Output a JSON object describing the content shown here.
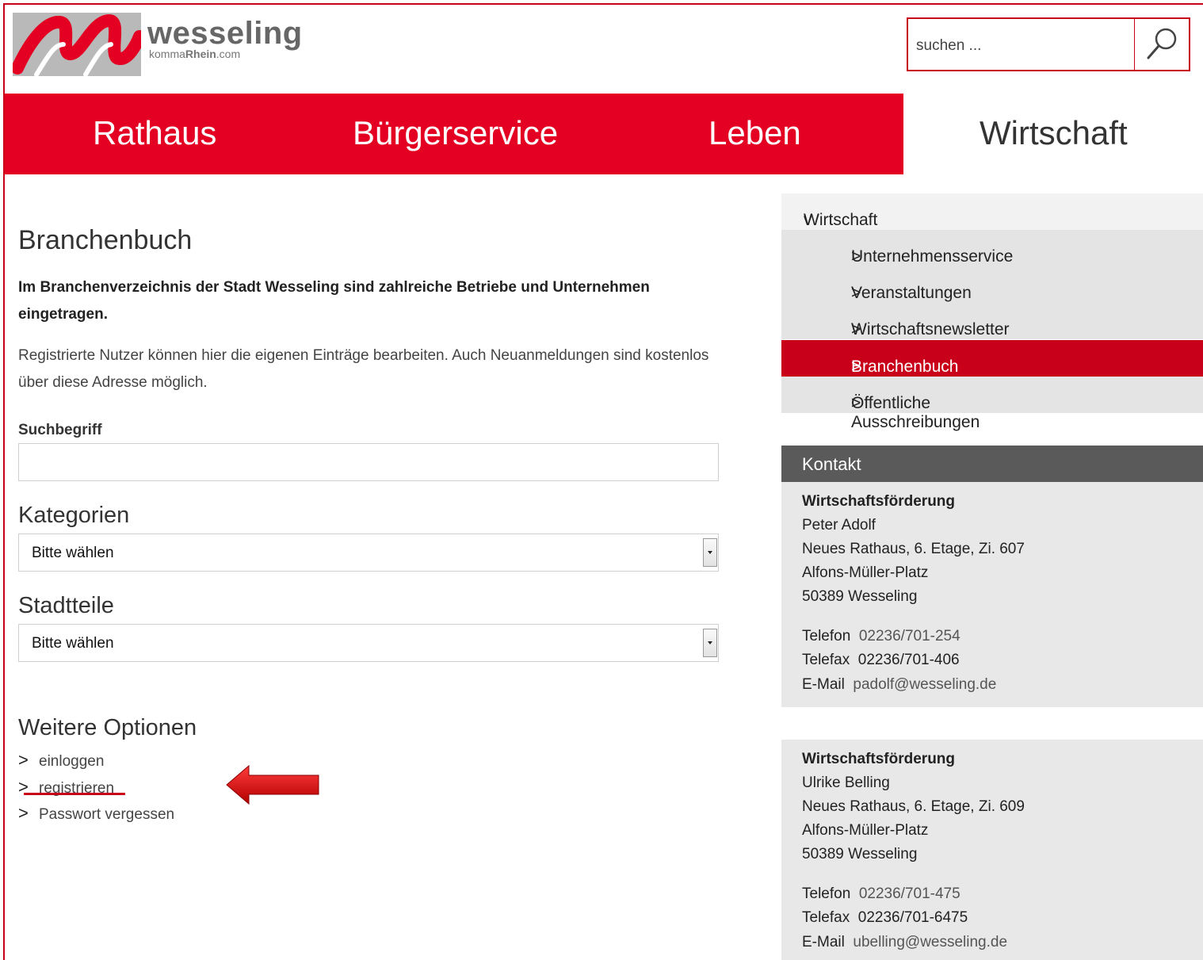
{
  "header": {
    "logo_word": "wesseling",
    "logo_sub_plain": "komma",
    "logo_sub_bold": "Rhein",
    "logo_sub_tail": ".com",
    "search_placeholder": "suchen ..."
  },
  "nav": {
    "items": [
      "Rathaus",
      "Bürgerservice",
      "Leben"
    ],
    "active": "Wirtschaft"
  },
  "main": {
    "title": "Branchenbuch",
    "intro": "Im Branchenverzeichnis der Stadt Wesseling sind zahlreiche Betriebe und Unternehmen eingetragen.",
    "paragraph": "Registrierte Nutzer können hier die eigenen Einträge bearbeiten. Auch Neuanmeldungen sind kostenlos über diese Adresse möglich.",
    "search_label": "Suchbegriff",
    "search_value": "",
    "categories_heading": "Kategorien",
    "categories_value": "Bitte wählen",
    "districts_heading": "Stadtteile",
    "districts_value": "Bitte wählen",
    "options_heading": "Weitere Optionen",
    "options": [
      "einloggen",
      "registrieren",
      "Passwort vergessen"
    ]
  },
  "sidebar": {
    "section_title": "Wirtschaft",
    "section_marker": "v",
    "item_marker": ">",
    "items": [
      "Unternehmensservice",
      "Veranstaltungen",
      "Wirtschaftsnewsletter",
      "Branchenbuch",
      "Öffentliche Ausschreibungen"
    ],
    "active_index": 3
  },
  "contact": {
    "heading": "Kontakt",
    "cards": [
      {
        "dept": "Wirtschaftsförderung",
        "name": "Peter Adolf",
        "address1": "Neues Rathaus, 6. Etage, Zi. 607",
        "address2": "Alfons-Müller-Platz",
        "city": "50389 Wesseling",
        "phone_label": "Telefon",
        "phone": "02236/701-254",
        "fax_label": "Telefax",
        "fax": "02236/701-406",
        "email_label": "E-Mail",
        "email": "padolf@wesseling.de"
      },
      {
        "dept": "Wirtschaftsförderung",
        "name": "Ulrike Belling",
        "address1": "Neues Rathaus, 6. Etage, Zi. 609",
        "address2": "Alfons-Müller-Platz",
        "city": "50389 Wesseling",
        "phone_label": "Telefon",
        "phone": "02236/701-475",
        "fax_label": "Telefax",
        "fax": "02236/701-6475",
        "email_label": "E-Mail",
        "email": "ubelling@wesseling.de"
      }
    ]
  },
  "colors": {
    "brand_red": "#e30022",
    "active_red": "#c8001a",
    "sidebar_gray": "#e4e4e4",
    "kontakt_header": "#5a5a5a"
  },
  "annotation": {
    "arrow_icon": "red-arrow-left-icon"
  }
}
